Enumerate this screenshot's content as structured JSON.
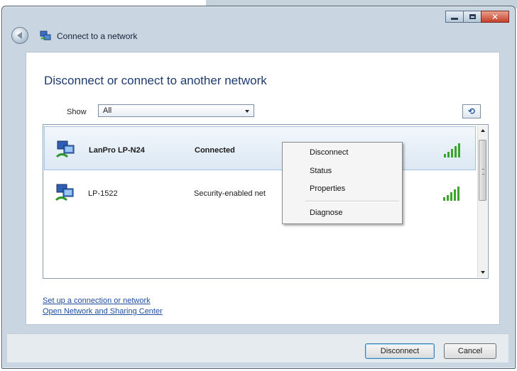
{
  "window": {
    "title": "Connect to a network",
    "icons": [
      "back-icon",
      "network-icon",
      "minimize-icon",
      "maximize-icon",
      "close-icon"
    ]
  },
  "main": {
    "heading": "Disconnect or connect to another network",
    "show_label": "Show",
    "show_value": "All",
    "refresh_icon": "⟲"
  },
  "networks": [
    {
      "name": "LanPro LP-N24",
      "status": "Connected",
      "selected": true
    },
    {
      "name": "LP-1522",
      "status": "Security-enabled net",
      "selected": false
    }
  ],
  "context_menu": {
    "items": [
      "Disconnect",
      "Status",
      "Properties",
      "Diagnose"
    ]
  },
  "links": {
    "setup": "Set up a connection or network",
    "sharing_center": "Open Network and Sharing Center"
  },
  "buttons": {
    "disconnect": "Disconnect",
    "cancel": "Cancel"
  },
  "colors": {
    "heading": "#1e3a6e",
    "link": "#1f4ea1",
    "signal": "#3aa52a",
    "selection": "#dce8f3"
  }
}
